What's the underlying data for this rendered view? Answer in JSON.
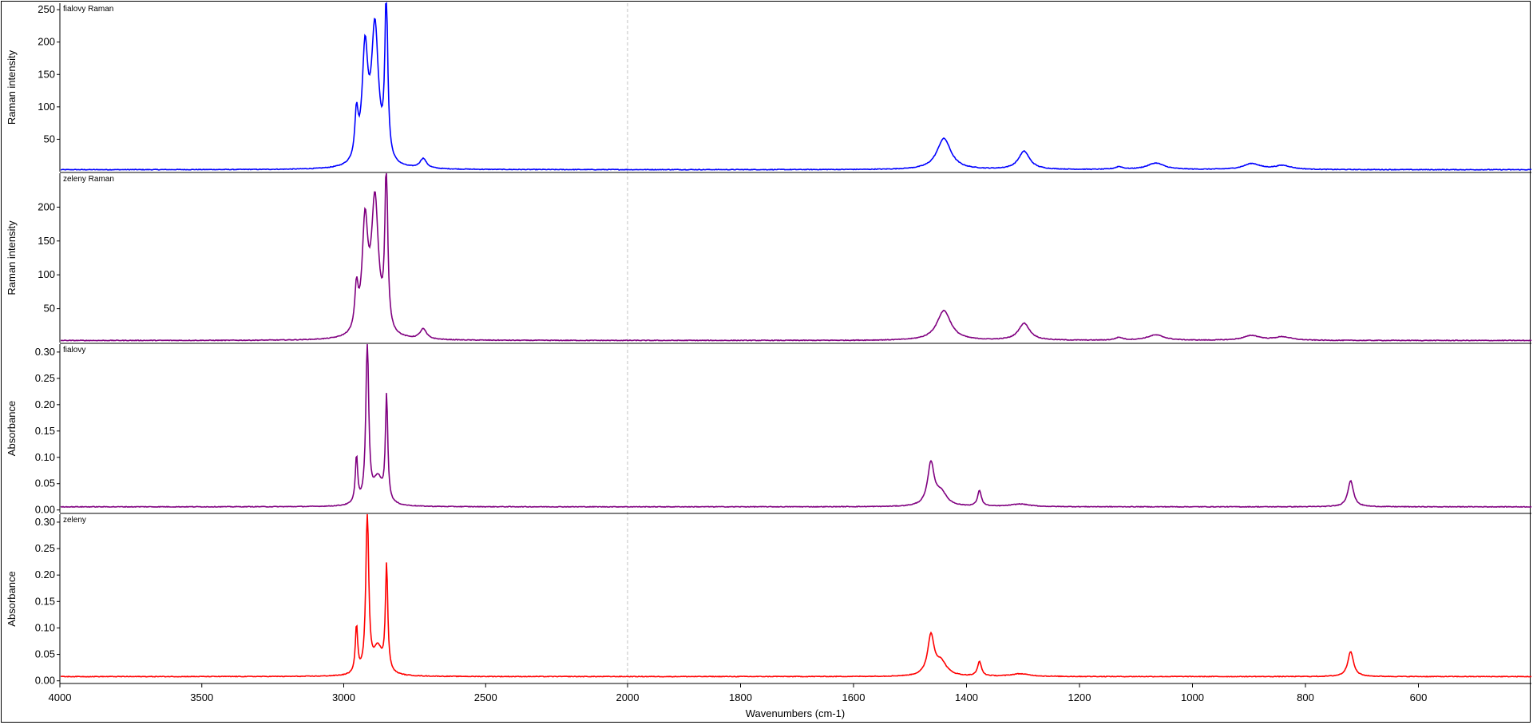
{
  "chart_data": {
    "type": "line",
    "x_axis": {
      "label": "Wavenumbers (cm-1)",
      "range": [
        4000,
        400
      ],
      "ticks": [
        4000,
        3500,
        3000,
        2500,
        2000,
        1800,
        1600,
        1400,
        1200,
        1000,
        800,
        600
      ],
      "segments": [
        {
          "from": 4000,
          "to": 2000
        },
        {
          "from": 2000,
          "to": 400
        }
      ],
      "separator_at": 2000
    },
    "panels": [
      {
        "title": "fialovy Raman",
        "ylabel": "Raman intensity",
        "color": "#0000ff",
        "ylim": [
          0,
          260
        ],
        "yticks": [
          "50",
          "100",
          "150",
          "200",
          "250"
        ],
        "yticks_values": [
          50,
          100,
          150,
          200,
          250
        ],
        "baseline": 3,
        "peaks": [
          {
            "x": 2955,
            "h": 70,
            "w": 7
          },
          {
            "x": 2925,
            "h": 170,
            "w": 12
          },
          {
            "x": 2890,
            "h": 210,
            "w": 15
          },
          {
            "x": 2850,
            "h": 255,
            "w": 6
          },
          {
            "x": 2720,
            "h": 15,
            "w": 14
          },
          {
            "x": 1440,
            "h": 48,
            "w": 15
          },
          {
            "x": 1298,
            "h": 28,
            "w": 12
          },
          {
            "x": 1130,
            "h": 4,
            "w": 8
          },
          {
            "x": 1065,
            "h": 10,
            "w": 18
          },
          {
            "x": 895,
            "h": 9,
            "w": 18
          },
          {
            "x": 840,
            "h": 6,
            "w": 18
          }
        ]
      },
      {
        "title": "zeleny Raman",
        "ylabel": "Raman intensity",
        "color": "#800080",
        "ylim": [
          0,
          250
        ],
        "yticks": [
          "50",
          "100",
          "150",
          "200"
        ],
        "yticks_values": [
          50,
          100,
          150,
          200
        ],
        "baseline": 3,
        "peaks": [
          {
            "x": 2955,
            "h": 62,
            "w": 7
          },
          {
            "x": 2925,
            "h": 160,
            "w": 12
          },
          {
            "x": 2890,
            "h": 198,
            "w": 15
          },
          {
            "x": 2850,
            "h": 240,
            "w": 6
          },
          {
            "x": 2720,
            "h": 15,
            "w": 14
          },
          {
            "x": 1440,
            "h": 44,
            "w": 15
          },
          {
            "x": 1298,
            "h": 25,
            "w": 12
          },
          {
            "x": 1130,
            "h": 4,
            "w": 8
          },
          {
            "x": 1065,
            "h": 8,
            "w": 18
          },
          {
            "x": 895,
            "h": 7,
            "w": 18
          },
          {
            "x": 840,
            "h": 5,
            "w": 18
          }
        ]
      },
      {
        "title": "fialovy",
        "ylabel": "Absorbance",
        "color": "#800080",
        "ylim": [
          -0.005,
          0.315
        ],
        "yticks": [
          "0.00",
          "0.05",
          "0.10",
          "0.15",
          "0.20",
          "0.25",
          "0.30"
        ],
        "yticks_values": [
          0.0,
          0.05,
          0.1,
          0.15,
          0.2,
          0.25,
          0.3
        ],
        "baseline": 0.006,
        "peaks": [
          {
            "x": 2955,
            "h": 0.09,
            "w": 5
          },
          {
            "x": 2917,
            "h": 0.31,
            "w": 6
          },
          {
            "x": 2880,
            "h": 0.05,
            "w": 20
          },
          {
            "x": 2849,
            "h": 0.2,
            "w": 5
          },
          {
            "x": 1463,
            "h": 0.08,
            "w": 7
          },
          {
            "x": 1445,
            "h": 0.025,
            "w": 12
          },
          {
            "x": 1377,
            "h": 0.03,
            "w": 4
          },
          {
            "x": 1305,
            "h": 0.005,
            "w": 20
          },
          {
            "x": 720,
            "h": 0.05,
            "w": 6
          }
        ]
      },
      {
        "title": "zeleny",
        "ylabel": "Absorbance",
        "color": "#ff0000",
        "ylim": [
          -0.005,
          0.315
        ],
        "yticks": [
          "0.00",
          "0.05",
          "0.10",
          "0.15",
          "0.20",
          "0.25",
          "0.30"
        ],
        "yticks_values": [
          0.0,
          0.05,
          0.1,
          0.15,
          0.2,
          0.25,
          0.3
        ],
        "baseline": 0.008,
        "peaks": [
          {
            "x": 2955,
            "h": 0.09,
            "w": 5
          },
          {
            "x": 2917,
            "h": 0.31,
            "w": 6
          },
          {
            "x": 2880,
            "h": 0.05,
            "w": 20
          },
          {
            "x": 2849,
            "h": 0.2,
            "w": 5
          },
          {
            "x": 1463,
            "h": 0.075,
            "w": 7
          },
          {
            "x": 1445,
            "h": 0.025,
            "w": 12
          },
          {
            "x": 1377,
            "h": 0.028,
            "w": 4
          },
          {
            "x": 1305,
            "h": 0.005,
            "w": 20
          },
          {
            "x": 720,
            "h": 0.048,
            "w": 6
          }
        ]
      }
    ]
  }
}
